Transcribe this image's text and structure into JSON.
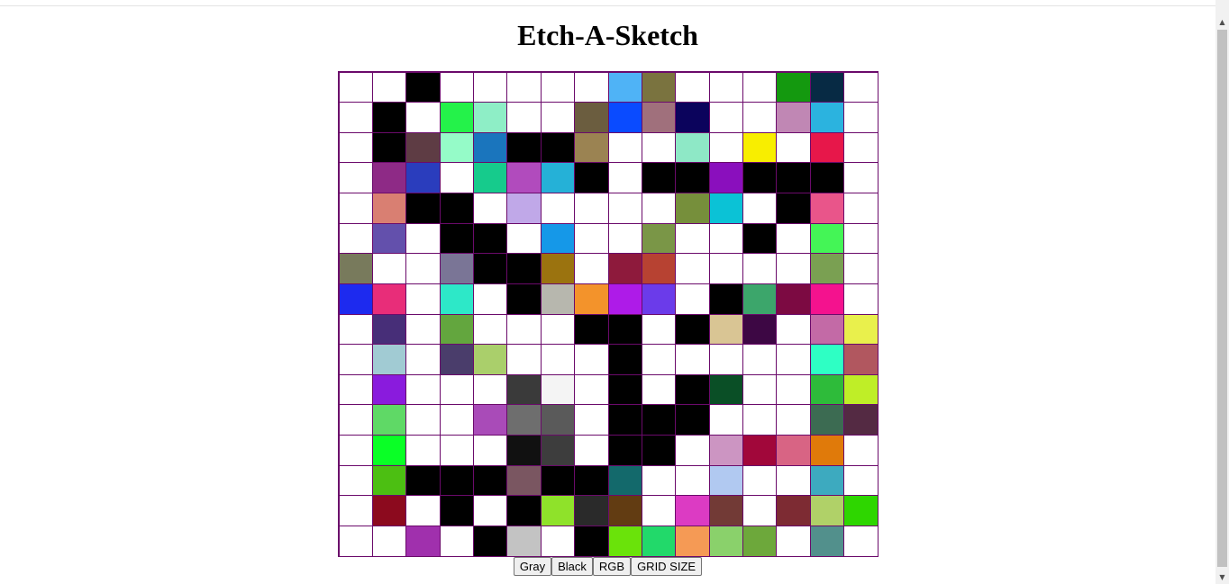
{
  "page": {
    "title": "Etch-A-Sketch"
  },
  "grid": {
    "size": 16,
    "rows": [
      [
        "#ffffff",
        "#ffffff",
        "#000000",
        "#ffffff",
        "#ffffff",
        "#ffffff",
        "#ffffff",
        "#ffffff",
        "#4fb3f6",
        "#7a733f",
        "#ffffff",
        "#ffffff",
        "#ffffff",
        "#14990f",
        "#072a44",
        "#ffffff"
      ],
      [
        "#ffffff",
        "#000000",
        "#ffffff",
        "#24f24a",
        "#8eeec6",
        "#ffffff",
        "#ffffff",
        "#6b5d3f",
        "#0a4bff",
        "#a0707c",
        "#0b035c",
        "#ffffff",
        "#ffffff",
        "#c087b4",
        "#2bb3df",
        "#ffffff"
      ],
      [
        "#ffffff",
        "#000000",
        "#5e3c44",
        "#95fbc8",
        "#1a75bd",
        "#000000",
        "#000000",
        "#9b8352",
        "#ffffff",
        "#ffffff",
        "#8ee8c6",
        "#ffffff",
        "#f8ee00",
        "#ffffff",
        "#e7174a",
        "#ffffff"
      ],
      [
        "#ffffff",
        "#8e2a86",
        "#2a3dbd",
        "#ffffff",
        "#16cb8c",
        "#b14bbd",
        "#25b1d7",
        "#000000",
        "#ffffff",
        "#000000",
        "#000000",
        "#8a0fbd",
        "#000000",
        "#000000",
        "#000000",
        "#ffffff"
      ],
      [
        "#ffffff",
        "#d97f72",
        "#000000",
        "#000000",
        "#ffffff",
        "#c0a8e8",
        "#ffffff",
        "#ffffff",
        "#ffffff",
        "#ffffff",
        "#768f3b",
        "#0bc2d6",
        "#ffffff",
        "#000000",
        "#e9558a",
        "#ffffff"
      ],
      [
        "#ffffff",
        "#6350ac",
        "#ffffff",
        "#000000",
        "#000000",
        "#ffffff",
        "#1598e8",
        "#ffffff",
        "#ffffff",
        "#7a9647",
        "#ffffff",
        "#ffffff",
        "#000000",
        "#ffffff",
        "#44f556",
        "#ffffff"
      ],
      [
        "#787a5c",
        "#ffffff",
        "#ffffff",
        "#7a7596",
        "#000000",
        "#000000",
        "#9b730f",
        "#ffffff",
        "#8e1a3c",
        "#b74232",
        "#ffffff",
        "#ffffff",
        "#ffffff",
        "#ffffff",
        "#7aa052",
        "#ffffff"
      ],
      [
        "#1d2aef",
        "#e82d79",
        "#ffffff",
        "#2de8c8",
        "#ffffff",
        "#000000",
        "#b7b7ae",
        "#f3932b",
        "#ae1be8",
        "#6b3bea",
        "#ffffff",
        "#000000",
        "#3ca66b",
        "#7c0a42",
        "#f4128e",
        "#ffffff"
      ],
      [
        "#ffffff",
        "#472e78",
        "#ffffff",
        "#63a63e",
        "#ffffff",
        "#ffffff",
        "#ffffff",
        "#000000",
        "#000000",
        "#ffffff",
        "#000000",
        "#d9c594",
        "#3d0744",
        "#ffffff",
        "#c36aa6",
        "#e9f04c"
      ],
      [
        "#ffffff",
        "#a1cbd3",
        "#ffffff",
        "#4a3d6b",
        "#aacf6b",
        "#ffffff",
        "#ffffff",
        "#ffffff",
        "#000000",
        "#ffffff",
        "#ffffff",
        "#ffffff",
        "#ffffff",
        "#ffffff",
        "#2effc4",
        "#b1575f"
      ],
      [
        "#ffffff",
        "#8a1bdd",
        "#ffffff",
        "#ffffff",
        "#ffffff",
        "#3a3a3a",
        "#f4f4f4",
        "#ffffff",
        "#000000",
        "#ffffff",
        "#000000",
        "#0a4f26",
        "#ffffff",
        "#ffffff",
        "#2ebb3a",
        "#bfee27"
      ],
      [
        "#ffffff",
        "#5fd966",
        "#ffffff",
        "#ffffff",
        "#a94bb8",
        "#6e6e6e",
        "#5a5a5a",
        "#ffffff",
        "#000000",
        "#000000",
        "#000000",
        "#ffffff",
        "#ffffff",
        "#ffffff",
        "#3c6b52",
        "#542a43"
      ],
      [
        "#ffffff",
        "#0aff26",
        "#ffffff",
        "#ffffff",
        "#ffffff",
        "#111111",
        "#3d3d3d",
        "#ffffff",
        "#000000",
        "#000000",
        "#ffffff",
        "#cc95c2",
        "#a1073a",
        "#d86484",
        "#e07a0a",
        "#ffffff"
      ],
      [
        "#ffffff",
        "#4cbf12",
        "#000000",
        "#000000",
        "#000000",
        "#7a5661",
        "#000000",
        "#000000",
        "#13696b",
        "#ffffff",
        "#ffffff",
        "#b1c9f1",
        "#ffffff",
        "#ffffff",
        "#3daabf",
        "#ffffff"
      ],
      [
        "#ffffff",
        "#8c0a1e",
        "#ffffff",
        "#000000",
        "#ffffff",
        "#000000",
        "#8fe22a",
        "#2a2a2a",
        "#623c12",
        "#ffffff",
        "#dc3bc3",
        "#723a36",
        "#ffffff",
        "#7d2b33",
        "#b0d168",
        "#2ed600"
      ],
      [
        "#ffffff",
        "#ffffff",
        "#a030ad",
        "#ffffff",
        "#000000",
        "#c3c3c3",
        "#ffffff",
        "#000000",
        "#6ae30a",
        "#22d96a",
        "#f59a55",
        "#8ad16b",
        "#6da83b",
        "#ffffff",
        "#52908c",
        "#ffffff"
      ]
    ]
  },
  "controls": {
    "gray_label": "Gray",
    "black_label": "Black",
    "rgb_label": "RGB",
    "grid_size_label": "GRID SIZE"
  },
  "scrollbar": {
    "up_icon": "triangle-up-icon",
    "down_icon": "triangle-down-icon"
  }
}
